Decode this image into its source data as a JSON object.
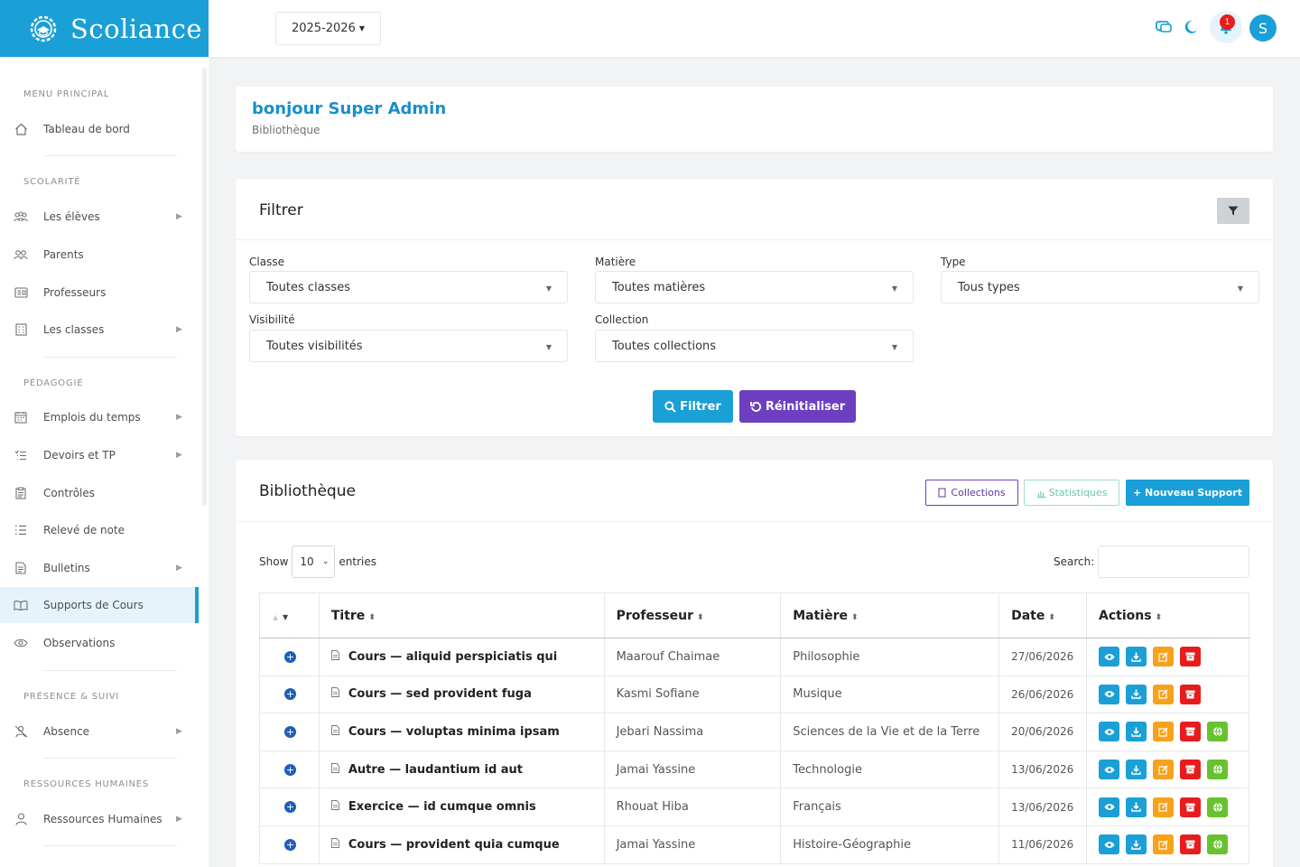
{
  "app": {
    "name": "Scoliance"
  },
  "header": {
    "year": "2025-2026",
    "notifications_count": "1",
    "avatar_letter": "S"
  },
  "sidebar": {
    "sections": [
      {
        "label": "MENU PRINCIPAL"
      },
      {
        "label": "SCOLARITÉ"
      },
      {
        "label": "PÉDAGOGIE"
      },
      {
        "label": "PRÉSENCE & SUIVI"
      },
      {
        "label": "RESSOURCES HUMAINES"
      }
    ],
    "items": [
      {
        "label": "Tableau de bord"
      },
      {
        "label": "Les élèves"
      },
      {
        "label": "Parents"
      },
      {
        "label": "Professeurs"
      },
      {
        "label": "Les classes"
      },
      {
        "label": "Emplois du temps"
      },
      {
        "label": "Devoirs et TP"
      },
      {
        "label": "Contrôles"
      },
      {
        "label": "Relevé de note"
      },
      {
        "label": "Bulletins"
      },
      {
        "label": "Supports de Cours"
      },
      {
        "label": "Observations"
      },
      {
        "label": "Absence"
      },
      {
        "label": "Ressources Humaines"
      }
    ]
  },
  "greeting": {
    "title": "bonjour Super Admin",
    "subtitle": "Bibliothèque"
  },
  "filter": {
    "title": "Filtrer",
    "fields": [
      {
        "label": "Classe",
        "value": "Toutes classes"
      },
      {
        "label": "Matière",
        "value": "Toutes matières"
      },
      {
        "label": "Type",
        "value": "Tous types"
      },
      {
        "label": "Visibilité",
        "value": "Toutes visibilités"
      },
      {
        "label": "Collection",
        "value": "Toutes collections"
      }
    ],
    "filter_button": "Filtrer",
    "reset_button": "Réinitialiser"
  },
  "library": {
    "title": "Bibliothèque",
    "collections_button": "Collections",
    "stats_button": "Statistiques",
    "new_button": "+ Nouveau Support",
    "show_label": "Show",
    "page_length": "10",
    "entries_label": "entries",
    "search_label": "Search:",
    "columns": [
      "Titre",
      "Professeur",
      "Matière",
      "Date",
      "Actions"
    ],
    "rows": [
      {
        "titre": "Cours — aliquid perspiciatis qui",
        "professeur": "Maarouf Chaimae",
        "matiere": "Philosophie",
        "date": "27/06/2026",
        "published": false
      },
      {
        "titre": "Cours — sed provident fuga",
        "professeur": "Kasmi Sofiane",
        "matiere": "Musique",
        "date": "26/06/2026",
        "published": false
      },
      {
        "titre": "Cours — voluptas minima ipsam",
        "professeur": "Jebari Nassima",
        "matiere": "Sciences de la Vie et de la Terre",
        "date": "20/06/2026",
        "published": true
      },
      {
        "titre": "Autre — laudantium id aut",
        "professeur": "Jamai Yassine",
        "matiere": "Technologie",
        "date": "13/06/2026",
        "published": true
      },
      {
        "titre": "Exercice — id cumque omnis",
        "professeur": "Rhouat Hiba",
        "matiere": "Français",
        "date": "13/06/2026",
        "published": true
      },
      {
        "titre": "Cours — provident quia cumque",
        "professeur": "Jamai Yassine",
        "matiere": "Histoire-Géographie",
        "date": "11/06/2026",
        "published": true
      }
    ]
  },
  "colors": {
    "primary": "#1a9fd6",
    "purple": "#6c3fc0",
    "edit": "#f7a21b",
    "archive": "#e81c1c",
    "publish": "#66c22f"
  }
}
